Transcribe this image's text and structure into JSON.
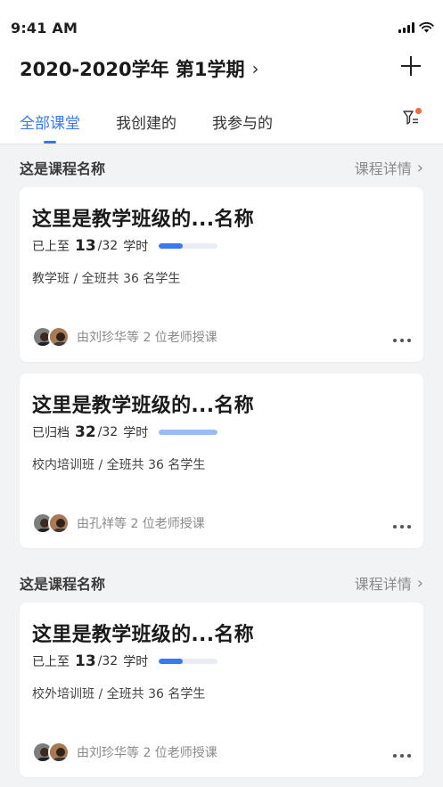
{
  "status_bar": {
    "time": "9:41 AM"
  },
  "header": {
    "title": "2020-2020学年 第1学期"
  },
  "tabs": [
    {
      "label": "全部课堂",
      "active": true
    },
    {
      "label": "我创建的",
      "active": false
    },
    {
      "label": "我参与的",
      "active": false
    }
  ],
  "sections": [
    {
      "title": "这是课程名称",
      "link": "课程详情",
      "cards": [
        {
          "title": "这里是教学班级的...名称",
          "status": "已上至",
          "done": "13",
          "total": "/32",
          "unit": "学时",
          "progress": 0.4,
          "meta": "教学班 / 全班共 36 名学生",
          "teachers": "由刘珍华等 2 位老师授课"
        },
        {
          "title": "这里是教学班级的...名称",
          "status": "已归档",
          "done": "32",
          "total": "/32",
          "unit": "学时",
          "progress": 1.0,
          "meta": "校内培训班 / 全班共 36 名学生",
          "teachers": "由孔祥等 2 位老师授课"
        }
      ]
    },
    {
      "title": "这是课程名称",
      "link": "课程详情",
      "cards": [
        {
          "title": "这里是教学班级的...名称",
          "status": "已上至",
          "done": "13",
          "total": "/32",
          "unit": "学时",
          "progress": 0.4,
          "meta": "校外培训班 / 全班共 36 名学生",
          "teachers": "由刘珍华等 2 位老师授课"
        }
      ]
    }
  ],
  "colors": {
    "accent": "#3a78f2",
    "archived": "#9bbbf5",
    "badge": "#f26b3a"
  }
}
